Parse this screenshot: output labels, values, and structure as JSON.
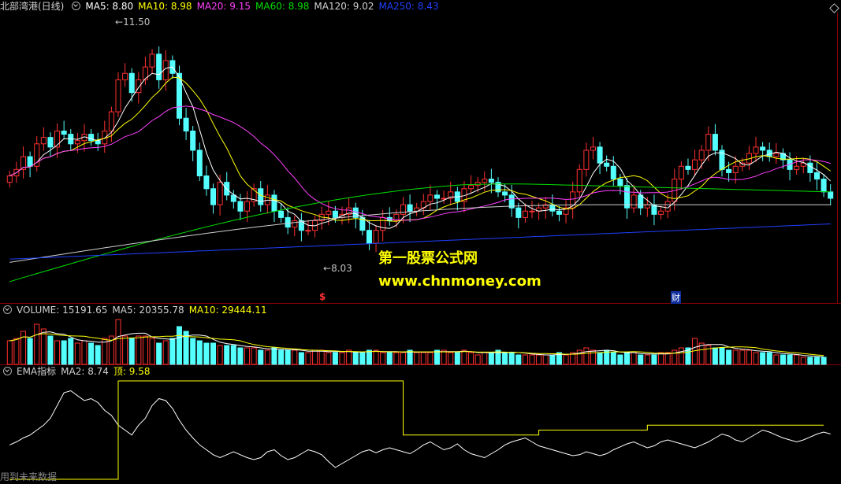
{
  "main": {
    "title": "北部湾港(日线)",
    "ma5": "MA5: 8.80",
    "ma10": "MA10: 8.98",
    "ma20": "MA20: 9.15",
    "ma60": "MA60: 8.98",
    "ma120": "MA120: 9.02",
    "ma250": "MA250: 8.43",
    "high_label": "11.50",
    "low_label": "8.03",
    "marker_s": "$",
    "marker_cai": "财"
  },
  "volume": {
    "label": "VOLUME: 15191.65",
    "ma5": "MA5: 20355.78",
    "ma10": "MA10: 29444.11"
  },
  "ema": {
    "label": "EMA指标",
    "ma2": "MA2: 8.74",
    "top": "顶: 9.58"
  },
  "watermark": {
    "line1": "第一股票公式网",
    "line2": "www.chnmoney.com"
  },
  "footer": "用到未来数据",
  "colors": {
    "up": "#ff3030",
    "down": "#54ffff",
    "ma5": "#ffffff",
    "ma10": "#ffff00",
    "ma20": "#ff40ff",
    "ma60": "#00e000",
    "ma120": "#d0d0d0",
    "ma250": "#2040ff"
  },
  "chart_data": [
    {
      "type": "candlestick",
      "title": "北部湾港(日线)",
      "ylim": [
        7.6,
        11.9
      ],
      "annotations": [
        {
          "text": "11.50",
          "value": 11.5
        },
        {
          "text": "8.03",
          "value": 8.03
        }
      ],
      "closes": [
        9.4,
        9.5,
        9.7,
        9.55,
        9.9,
        10.0,
        9.85,
        10.1,
        10.05,
        9.9,
        9.95,
        10.05,
        9.95,
        9.9,
        10.1,
        10.4,
        10.9,
        11.0,
        10.7,
        10.9,
        11.1,
        11.3,
        10.9,
        11.2,
        11.0,
        10.3,
        10.1,
        9.8,
        9.4,
        9.2,
        8.95,
        9.3,
        9.1,
        9.0,
        8.85,
        9.0,
        9.2,
        8.95,
        9.1,
        8.85,
        8.75,
        8.6,
        8.7,
        8.55,
        8.55,
        8.7,
        8.8,
        8.85,
        8.75,
        8.8,
        8.9,
        8.75,
        8.55,
        8.35,
        8.55,
        8.75,
        8.7,
        8.8,
        8.95,
        8.85,
        8.9,
        9.0,
        9.1,
        9.05,
        9.05,
        9.15,
        9.0,
        9.2,
        9.25,
        9.3,
        9.35,
        9.3,
        9.15,
        9.1,
        8.9,
        8.75,
        8.85,
        8.85,
        8.9,
        8.95,
        8.85,
        8.8,
        8.9,
        9.15,
        9.5,
        9.8,
        9.85,
        9.6,
        9.55,
        9.35,
        9.25,
        8.9,
        9.1,
        8.9,
        8.95,
        8.8,
        8.85,
        9.0,
        9.35,
        9.55,
        9.5,
        9.65,
        9.8,
        10.05,
        9.8,
        9.5,
        9.45,
        9.55,
        9.6,
        9.75,
        9.85,
        9.8,
        9.7,
        9.75,
        9.65,
        9.5,
        9.55,
        9.6,
        9.45,
        9.35,
        9.15,
        9.05
      ]
    },
    {
      "type": "bar",
      "title": "VOLUME",
      "values": [
        0.5,
        0.55,
        0.7,
        0.55,
        0.85,
        0.75,
        0.6,
        0.5,
        0.5,
        0.55,
        0.45,
        0.5,
        0.45,
        0.4,
        0.55,
        0.6,
        0.95,
        0.6,
        0.55,
        0.6,
        0.6,
        0.55,
        0.45,
        0.5,
        0.55,
        0.8,
        0.7,
        0.55,
        0.5,
        0.45,
        0.45,
        0.4,
        0.4,
        0.4,
        0.35,
        0.35,
        0.35,
        0.3,
        0.3,
        0.35,
        0.3,
        0.3,
        0.3,
        0.25,
        0.25,
        0.3,
        0.3,
        0.25,
        0.25,
        0.25,
        0.3,
        0.25,
        0.25,
        0.3,
        0.3,
        0.25,
        0.25,
        0.25,
        0.25,
        0.3,
        0.25,
        0.25,
        0.25,
        0.3,
        0.3,
        0.25,
        0.25,
        0.3,
        0.25,
        0.2,
        0.25,
        0.25,
        0.3,
        0.25,
        0.25,
        0.2,
        0.2,
        0.2,
        0.2,
        0.2,
        0.2,
        0.25,
        0.2,
        0.25,
        0.3,
        0.35,
        0.3,
        0.25,
        0.3,
        0.25,
        0.2,
        0.25,
        0.25,
        0.2,
        0.2,
        0.2,
        0.25,
        0.25,
        0.3,
        0.35,
        0.35,
        0.55,
        0.45,
        0.4,
        0.35,
        0.35,
        0.3,
        0.3,
        0.3,
        0.3,
        0.25,
        0.25,
        0.25,
        0.2,
        0.2,
        0.2,
        0.2,
        0.15,
        0.15,
        0.15,
        0.15
      ]
    },
    {
      "type": "line",
      "title": "EMA指标",
      "series": [
        {
          "name": "MA2",
          "values": [
            0.35,
            0.38,
            0.42,
            0.45,
            0.5,
            0.55,
            0.62,
            0.75,
            0.88,
            0.9,
            0.85,
            0.8,
            0.82,
            0.78,
            0.7,
            0.65,
            0.55,
            0.5,
            0.45,
            0.55,
            0.62,
            0.75,
            0.82,
            0.8,
            0.72,
            0.6,
            0.5,
            0.42,
            0.35,
            0.3,
            0.25,
            0.22,
            0.25,
            0.28,
            0.25,
            0.22,
            0.2,
            0.22,
            0.28,
            0.3,
            0.24,
            0.2,
            0.22,
            0.26,
            0.3,
            0.28,
            0.25,
            0.18,
            0.12,
            0.16,
            0.2,
            0.24,
            0.28,
            0.3,
            0.27,
            0.3,
            0.32,
            0.3,
            0.28,
            0.26,
            0.3,
            0.35,
            0.38,
            0.34,
            0.3,
            0.32,
            0.36,
            0.3,
            0.26,
            0.24,
            0.22,
            0.26,
            0.3,
            0.35,
            0.38,
            0.4,
            0.42,
            0.38,
            0.34,
            0.32,
            0.3,
            0.28,
            0.26,
            0.24,
            0.25,
            0.28,
            0.26,
            0.24,
            0.26,
            0.3,
            0.33,
            0.36,
            0.38,
            0.35,
            0.32,
            0.34,
            0.38,
            0.4,
            0.38,
            0.36,
            0.34,
            0.32,
            0.35,
            0.38,
            0.42,
            0.46,
            0.44,
            0.4,
            0.38,
            0.42,
            0.46,
            0.5,
            0.48,
            0.45,
            0.42,
            0.4,
            0.38,
            0.4,
            0.43,
            0.46,
            0.48,
            0.46,
            0.44,
            0.42,
            0.4,
            0.36,
            0.32,
            0.28,
            0.28
          ]
        },
        {
          "name": "顶",
          "values": [
            0.0,
            0.0,
            0.0,
            0.0,
            0.0,
            0.0,
            0.0,
            0.0,
            0.0,
            0.0,
            0.0,
            0.0,
            0.0,
            0.0,
            0.0,
            0.0,
            1.0,
            1.0,
            1.0,
            1.0,
            1.0,
            1.0,
            1.0,
            1.0,
            1.0,
            1.0,
            1.0,
            1.0,
            1.0,
            1.0,
            1.0,
            1.0,
            1.0,
            1.0,
            1.0,
            1.0,
            1.0,
            1.0,
            1.0,
            1.0,
            1.0,
            1.0,
            1.0,
            1.0,
            1.0,
            1.0,
            1.0,
            1.0,
            1.0,
            1.0,
            1.0,
            1.0,
            1.0,
            1.0,
            1.0,
            1.0,
            1.0,
            1.0,
            0.45,
            0.45,
            0.45,
            0.45,
            0.45,
            0.45,
            0.45,
            0.45,
            0.45,
            0.45,
            0.45,
            0.45,
            0.45,
            0.45,
            0.45,
            0.45,
            0.45,
            0.45,
            0.45,
            0.45,
            0.5,
            0.5,
            0.5,
            0.5,
            0.5,
            0.5,
            0.5,
            0.5,
            0.5,
            0.5,
            0.5,
            0.5,
            0.5,
            0.5,
            0.5,
            0.5,
            0.55,
            0.55,
            0.55,
            0.55,
            0.55,
            0.55,
            0.55,
            0.55,
            0.55,
            0.55,
            0.55,
            0.55,
            0.55,
            0.55,
            0.55,
            0.55,
            0.55,
            0.55,
            0.55,
            0.55,
            0.55,
            0.55,
            0.55,
            0.55,
            0.55,
            0.55,
            0.55
          ]
        }
      ]
    }
  ]
}
